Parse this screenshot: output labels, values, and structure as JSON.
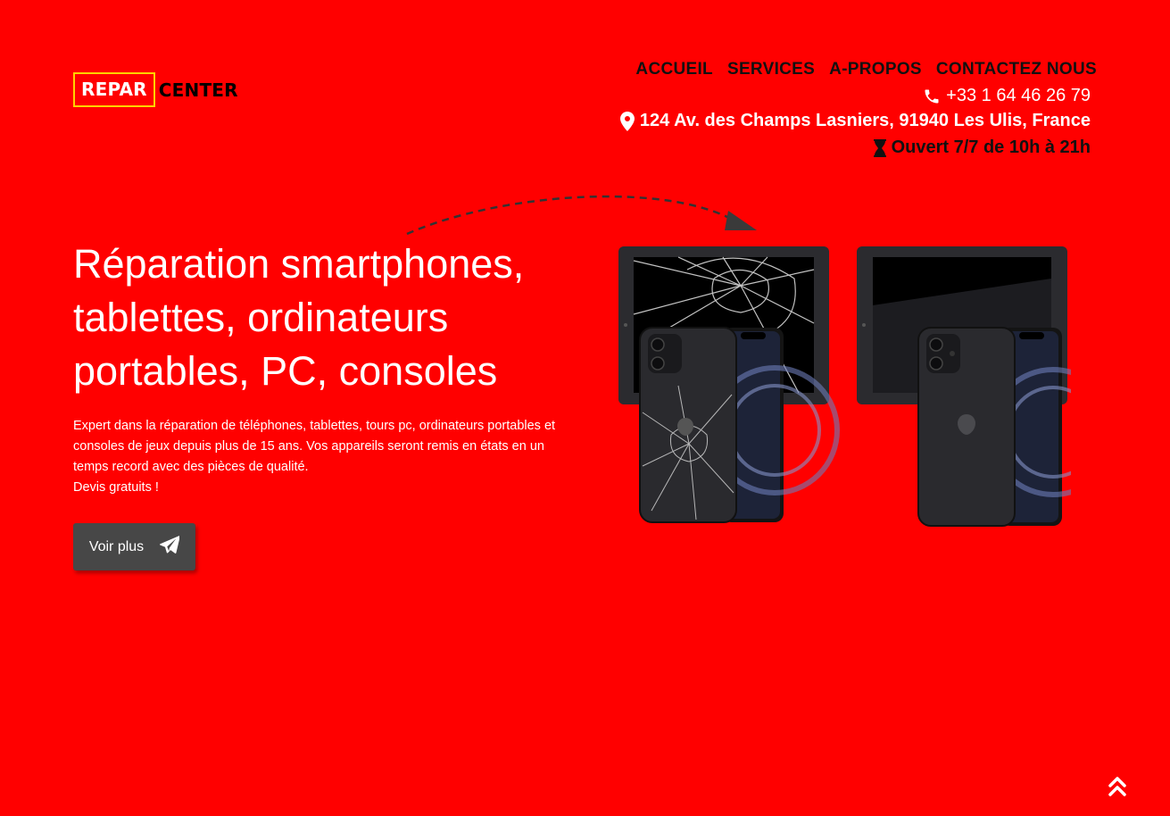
{
  "logo": {
    "part1": "REPAR",
    "part2": "CENTER"
  },
  "nav": [
    {
      "label": "ACCUEIL"
    },
    {
      "label": "SERVICES"
    },
    {
      "label": "A-PROPOS"
    },
    {
      "label": "CONTACTEZ NOUS"
    }
  ],
  "contact": {
    "phone": "+33 1 64 46 26 79",
    "address": "124 Av. des Champs Lasniers, 91940 Les Ulis, France",
    "hours": "Ouvert 7/7 de 10h à 21h",
    "phone_icon": "phone-icon",
    "address_icon": "map-pin-icon",
    "hours_icon": "hourglass-icon"
  },
  "hero": {
    "title": "Réparation smartphones, tablettes, ordinateurs portables, PC, consoles",
    "description": "Expert dans la réparation de téléphones, tablettes, tours pc, ordinateurs portables et consoles de jeux depuis plus de 15 ans. Vos appareils seront remis en états en un temps record avec des pièces de qualité.",
    "free_quote": "Devis gratuits !",
    "cta_label": "Voir plus",
    "cta_icon": "paper-plane-icon"
  },
  "colors": {
    "background": "#ff0000",
    "logo_border": "#ffd200",
    "button": "#474747"
  },
  "scroll_top_icon": "double-chevron-up-icon"
}
